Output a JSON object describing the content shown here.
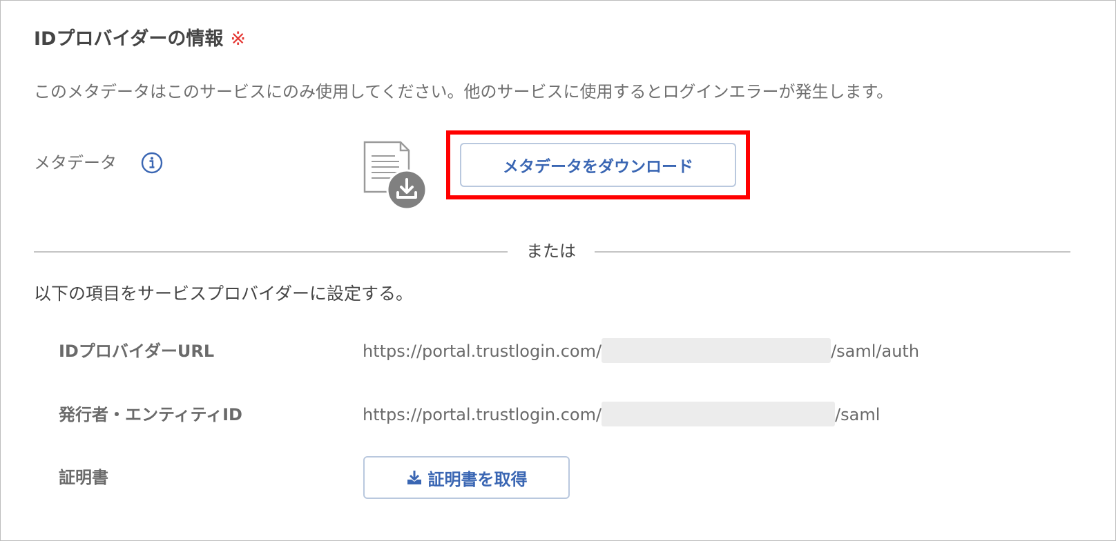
{
  "section": {
    "title": "IDプロバイダーの情報",
    "required_mark": "※"
  },
  "description": "このメタデータはこのサービスにのみ使用してください。他のサービスに使用するとログインエラーが発生します。",
  "metadata": {
    "label": "メタデータ",
    "download_button": "メタデータをダウンロード"
  },
  "divider_text": "または",
  "instruction": "以下の項目をサービスプロバイダーに設定する。",
  "rows": [
    {
      "label": "IDプロバイダーURL",
      "value_prefix": "https://portal.trustlogin.com/",
      "value_suffix": "/saml/auth"
    },
    {
      "label": "発行者・エンティティID",
      "value_prefix": "https://portal.trustlogin.com/",
      "value_suffix": "/saml"
    },
    {
      "label": "証明書",
      "button": "証明書を取得"
    }
  ],
  "icons": {
    "info": "info-circle-icon",
    "metadata_file": "document-download-icon",
    "certificate_download": "download-tray-icon"
  },
  "colors": {
    "accent": "#3a66b3",
    "required": "#e53935",
    "highlight": "#ff0000"
  }
}
